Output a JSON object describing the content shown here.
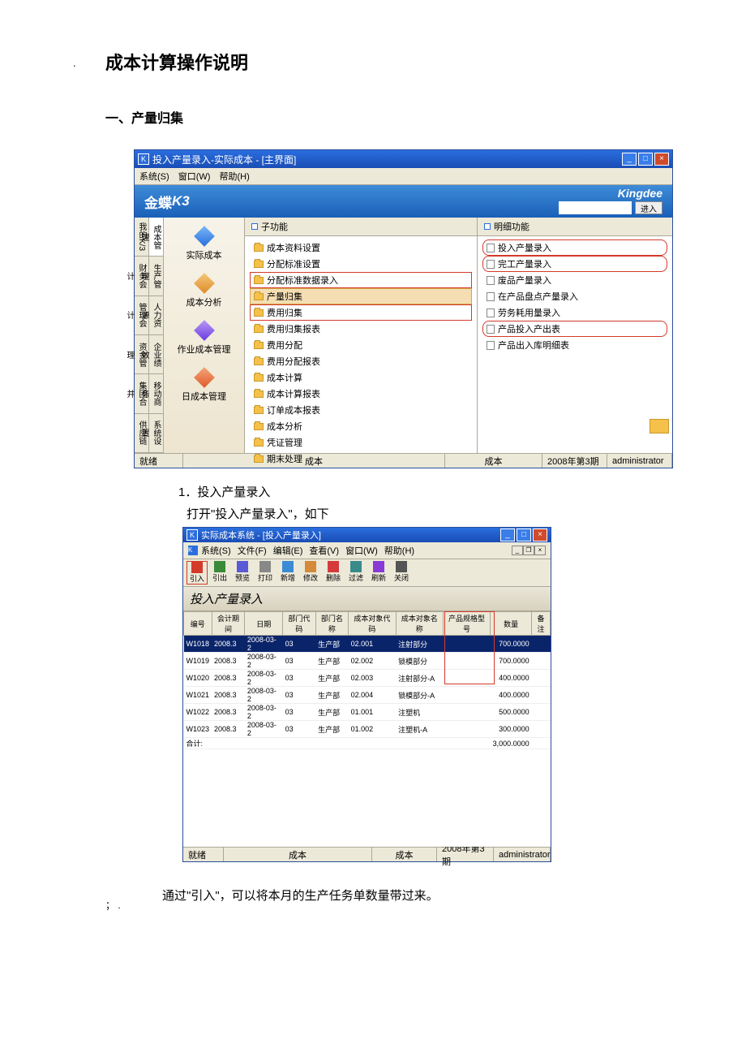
{
  "doc": {
    "title": "成本计算操作说明",
    "section1": "一、产量归集",
    "step1_num": "1．投入产量录入",
    "step1_text": "打开\"投入产量录入\"，如下",
    "note": "通过\"引入\"，可以将本月的生产任务单数量带过来。",
    "dot": ".",
    "footer": "；  ."
  },
  "ss1": {
    "title": "投入产量录入-实际成本 - [主界面]",
    "menu": [
      "系统(S)",
      "窗口(W)",
      "帮助(H)"
    ],
    "logo": "金蝶",
    "logo_k3": "K3",
    "kingdee": "Kingdee",
    "enter": "进入",
    "vtabs_left": [
      "我的K/3",
      "财务会计",
      "管理会计",
      "资金管理",
      "集团合并",
      "供应链"
    ],
    "vtabs_next": [
      "成本管理",
      "生产管理",
      "人力资源",
      "企业绩效",
      "移动商务",
      "系统设置"
    ],
    "nav": [
      {
        "label": "实际成本"
      },
      {
        "label": "成本分析"
      },
      {
        "label": "作业成本管理"
      },
      {
        "label": "日成本管理"
      }
    ],
    "mid_header": "子功能",
    "tree": [
      {
        "label": "成本资料设置"
      },
      {
        "label": "分配标准设置"
      },
      {
        "label": "分配标准数据录入",
        "red": true
      },
      {
        "label": "产量归集",
        "sel": true
      },
      {
        "label": "费用归集",
        "red": true
      },
      {
        "label": "费用归集报表"
      },
      {
        "label": "费用分配"
      },
      {
        "label": "费用分配报表"
      },
      {
        "label": "成本计算"
      },
      {
        "label": "成本计算报表"
      },
      {
        "label": "订单成本报表"
      },
      {
        "label": "成本分析"
      },
      {
        "label": "凭证管理"
      },
      {
        "label": "期末处理"
      }
    ],
    "right_header": "明细功能",
    "details": [
      {
        "label": "投入产量录入",
        "red": true
      },
      {
        "label": "完工产量录入",
        "red": true
      },
      {
        "label": "废品产量录入"
      },
      {
        "label": "在产品盘点产量录入"
      },
      {
        "label": "劳务耗用量录入"
      },
      {
        "label": "产品投入产出表",
        "red": true
      },
      {
        "label": "产品出入库明细表"
      }
    ],
    "status": {
      "ready": "就绪",
      "cost1": "成本",
      "cost2": "成本",
      "period": "2008年第3期",
      "user": "administrator"
    }
  },
  "ss2": {
    "title": "实际成本系统 - [投入产量录入]",
    "menu": [
      "系统(S)",
      "文件(F)",
      "编辑(E)",
      "查看(V)",
      "窗口(W)",
      "帮助(H)"
    ],
    "toolbar": [
      {
        "label": "引入",
        "red": true
      },
      {
        "label": "引出"
      },
      {
        "label": "预览"
      },
      {
        "label": "打印"
      },
      {
        "label": "新增"
      },
      {
        "label": "修改"
      },
      {
        "label": "删除"
      },
      {
        "label": "过滤"
      },
      {
        "label": "刷新"
      },
      {
        "label": "关闭"
      }
    ],
    "band_title": "投入产量录入",
    "columns": [
      "编号",
      "会计期间",
      "日期",
      "部门代码",
      "部门名称",
      "成本对象代码",
      "成本对象名称",
      "产品规格型号",
      "数量",
      "备注"
    ],
    "rows": [
      {
        "id": "W1018",
        "period": "2008.3",
        "date": "2008-03-2",
        "dept_code": "03",
        "dept_name": "生产部",
        "obj_code": "02.001",
        "obj_name": "注射部分",
        "spec": "",
        "qty": "700.0000",
        "hl": true
      },
      {
        "id": "W1019",
        "period": "2008.3",
        "date": "2008-03-2",
        "dept_code": "03",
        "dept_name": "生产部",
        "obj_code": "02.002",
        "obj_name": "锁模部分",
        "spec": "",
        "qty": "700.0000"
      },
      {
        "id": "W1020",
        "period": "2008.3",
        "date": "2008-03-2",
        "dept_code": "03",
        "dept_name": "生产部",
        "obj_code": "02.003",
        "obj_name": "注射部分-A",
        "spec": "",
        "qty": "400.0000"
      },
      {
        "id": "W1021",
        "period": "2008.3",
        "date": "2008-03-2",
        "dept_code": "03",
        "dept_name": "生产部",
        "obj_code": "02.004",
        "obj_name": "锁模部分-A",
        "spec": "",
        "qty": "400.0000"
      },
      {
        "id": "W1022",
        "period": "2008.3",
        "date": "2008-03-2",
        "dept_code": "03",
        "dept_name": "生产部",
        "obj_code": "01.001",
        "obj_name": "注塑机",
        "spec": "",
        "qty": "500.0000"
      },
      {
        "id": "W1023",
        "period": "2008.3",
        "date": "2008-03-2",
        "dept_code": "03",
        "dept_name": "生产部",
        "obj_code": "01.002",
        "obj_name": "注塑机-A",
        "spec": "",
        "qty": "300.0000"
      }
    ],
    "total_label": "合计:",
    "total_qty": "3,000.0000",
    "status": {
      "ready": "就绪",
      "cost1": "成本",
      "cost2": "成本",
      "period": "2008年第3期",
      "user": "administrator"
    }
  }
}
